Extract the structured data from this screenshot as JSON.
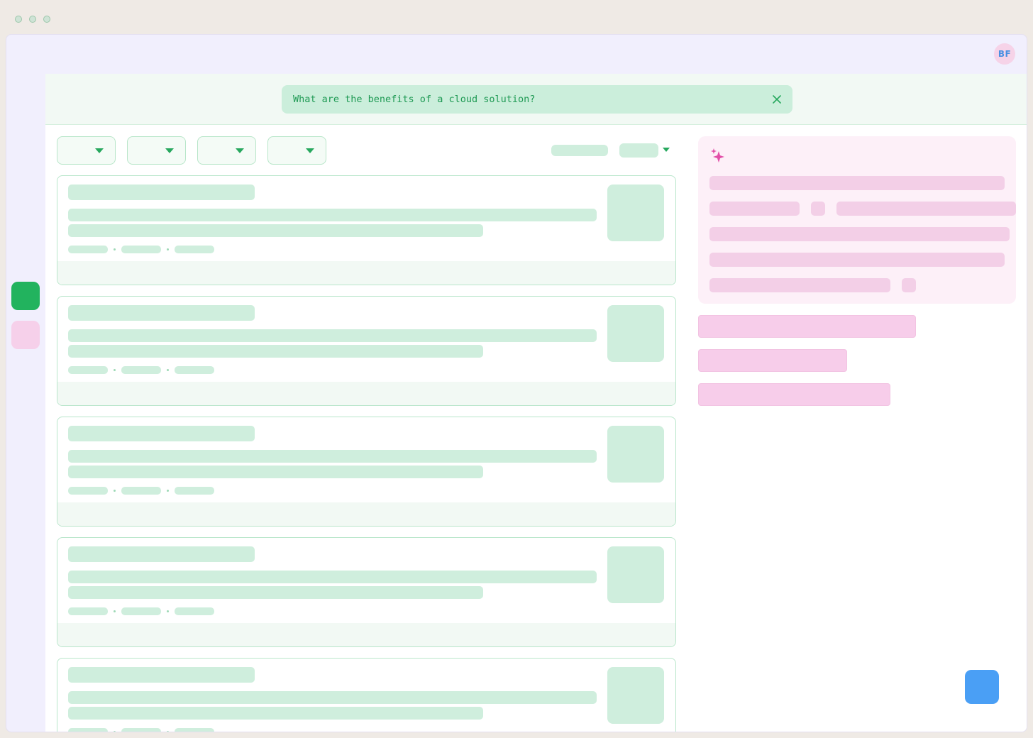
{
  "user": {
    "initials": "BF"
  },
  "search": {
    "query": "What are the benefits of a cloud solution?"
  },
  "icons": {
    "close": "close-icon",
    "sparkle": "sparkle-icon",
    "dropdown": "chevron-down-icon"
  },
  "colors": {
    "accent_green": "#27a85e",
    "active_rail": "#22b35e",
    "ai_pink": "#e24fa8",
    "fab_blue": "#4a9ff5"
  }
}
